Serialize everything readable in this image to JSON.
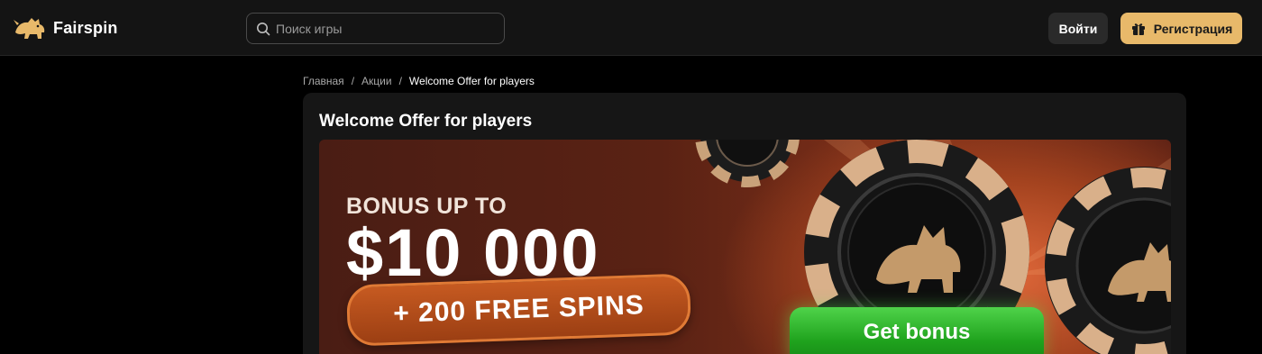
{
  "header": {
    "brand": "Fairspin",
    "search_placeholder": "Поиск игры",
    "login_label": "Войти",
    "register_label": "Регистрация"
  },
  "breadcrumb": {
    "items": [
      "Главная",
      "Акции"
    ],
    "separator": "/",
    "current": "Welcome Offer for players"
  },
  "promo": {
    "title": "Welcome Offer for players",
    "banner": {
      "headline": "BONUS UP TO",
      "amount": "$10 000",
      "extra": "+ 200 FREE SPINS",
      "cta": "Get bonus"
    }
  },
  "colors": {
    "accent": "#e8b96a",
    "background": "#000000",
    "header_bg": "#141414",
    "card_bg": "#161616",
    "cta_green": "#1fa21d"
  },
  "icons": {
    "logo": "lion-logo-icon",
    "search": "search-icon",
    "register": "gift-icon"
  }
}
